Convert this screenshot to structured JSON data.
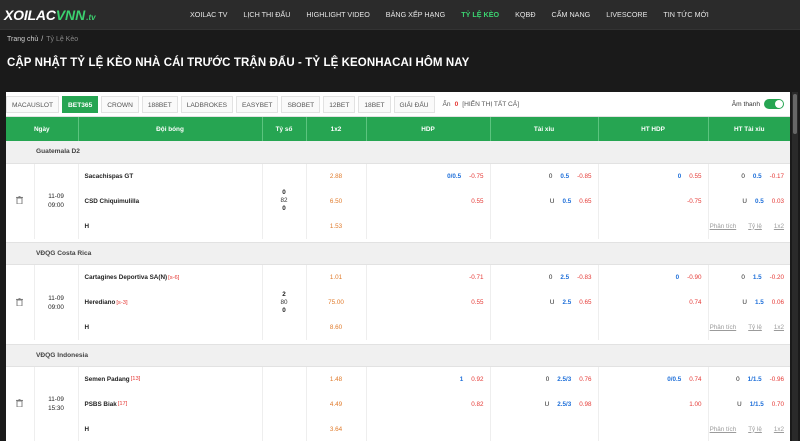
{
  "logo": {
    "part1": "XOILAC",
    "part2": "VNN",
    "suffix": ".tv"
  },
  "nav": [
    "XOILAC TV",
    "LỊCH THI ĐẤU",
    "HIGHLIGHT VIDEO",
    "BẢNG XẾP HẠNG",
    "TỶ LỆ KÈO",
    "KQBĐ",
    "CẨM NANG",
    "LIVESCORE",
    "TIN TỨC MỚI"
  ],
  "nav_active": 4,
  "breadcrumb": {
    "home": "Trang chủ",
    "sep": "/",
    "current": "Tỷ Lệ Kèo"
  },
  "page_title": "CẬP NHẬT TỶ LỆ KÈO NHÀ CÁI TRƯỚC TRẬN ĐẤU - TỶ LỆ KEONHACAI HÔM NAY",
  "bookies": [
    "MACAUSLOT",
    "BET365",
    "CROWN",
    "188BET",
    "LADBROKES",
    "EASYBET",
    "SBOBET",
    "12BET",
    "18BET",
    "GIẢI ĐẤU"
  ],
  "bookie_active": 1,
  "hide": {
    "label": "Ẩn",
    "count": "0",
    "show_all": "[HIỂN THỊ TẤT CẢ]"
  },
  "sound_label": "Âm thanh",
  "columns": [
    "Ngày",
    "Đội bóng",
    "Tỷ số",
    "1x2",
    "HDP",
    "Tài xỉu",
    "HT HDP",
    "HT Tài xỉu"
  ],
  "links": [
    "Phân tích",
    "Tỷ lệ",
    "1x2"
  ],
  "colors": {
    "accent": "#26a552",
    "odds_blue": "#1e6fd9",
    "odds_red": "#e53935",
    "x12": "#e07a2a"
  },
  "matches": [
    {
      "league": "Guatemala D2",
      "date": "11-09",
      "time": "09:00",
      "home": "Sacachispas GT",
      "home_rank": "",
      "away": "CSD Chiquimulilla",
      "away_rank": "",
      "draw": "H",
      "score": [
        "0",
        "82",
        "0"
      ],
      "x12": [
        "2.88",
        "6.50",
        "1.53"
      ],
      "hdp": [
        [
          "0/0.5",
          "-0.75"
        ],
        [
          "",
          "0.55"
        ]
      ],
      "ou": [
        [
          "0",
          "0.5",
          "-0.85"
        ],
        [
          "U",
          "0.5",
          "0.65"
        ]
      ],
      "ht_hdp": [
        [
          "0",
          "0.55"
        ],
        [
          "",
          "-0.75"
        ]
      ],
      "ht_ou": [
        [
          "0",
          "0.5",
          "-0.17"
        ],
        [
          "U",
          "0.5",
          "0.03"
        ]
      ]
    },
    {
      "league": "VĐQG Costa Rica",
      "date": "11-09",
      "time": "09:00",
      "home": "Cartagines Deportiva SA(N)",
      "home_rank": "[s-6]",
      "away": "Herediano",
      "away_rank": "[s-3]",
      "draw": "H",
      "score": [
        "2",
        "80",
        "0"
      ],
      "x12": [
        "1.01",
        "75.00",
        "8.60"
      ],
      "hdp": [
        [
          "",
          "-0.71"
        ],
        [
          "",
          "0.55"
        ]
      ],
      "ou": [
        [
          "0",
          "2.5",
          "-0.83"
        ],
        [
          "U",
          "2.5",
          "0.65"
        ]
      ],
      "ht_hdp": [
        [
          "0",
          "-0.90"
        ],
        [
          "",
          "0.74"
        ]
      ],
      "ht_ou": [
        [
          "0",
          "1.5",
          "-0.20"
        ],
        [
          "U",
          "1.5",
          "0.06"
        ]
      ]
    },
    {
      "league": "VĐQG Indonesia",
      "date": "11-09",
      "time": "15:30",
      "home": "Semen Padang",
      "home_rank": "[13]",
      "away": "PSBS Biak",
      "away_rank": "[17]",
      "draw": "H",
      "score": [
        "",
        "",
        ""
      ],
      "x12": [
        "1.48",
        "4.49",
        "3.64"
      ],
      "hdp": [
        [
          "1",
          "0.92"
        ],
        [
          "",
          "0.82"
        ]
      ],
      "ou": [
        [
          "0",
          "2.5/3",
          "0.76"
        ],
        [
          "U",
          "2.5/3",
          "0.98"
        ]
      ],
      "ht_hdp": [
        [
          "0/0.5",
          "0.74"
        ],
        [
          "",
          "1.00"
        ]
      ],
      "ht_ou": [
        [
          "0",
          "1/1.5",
          "-0.96"
        ],
        [
          "U",
          "1/1.5",
          "0.70"
        ]
      ]
    }
  ]
}
